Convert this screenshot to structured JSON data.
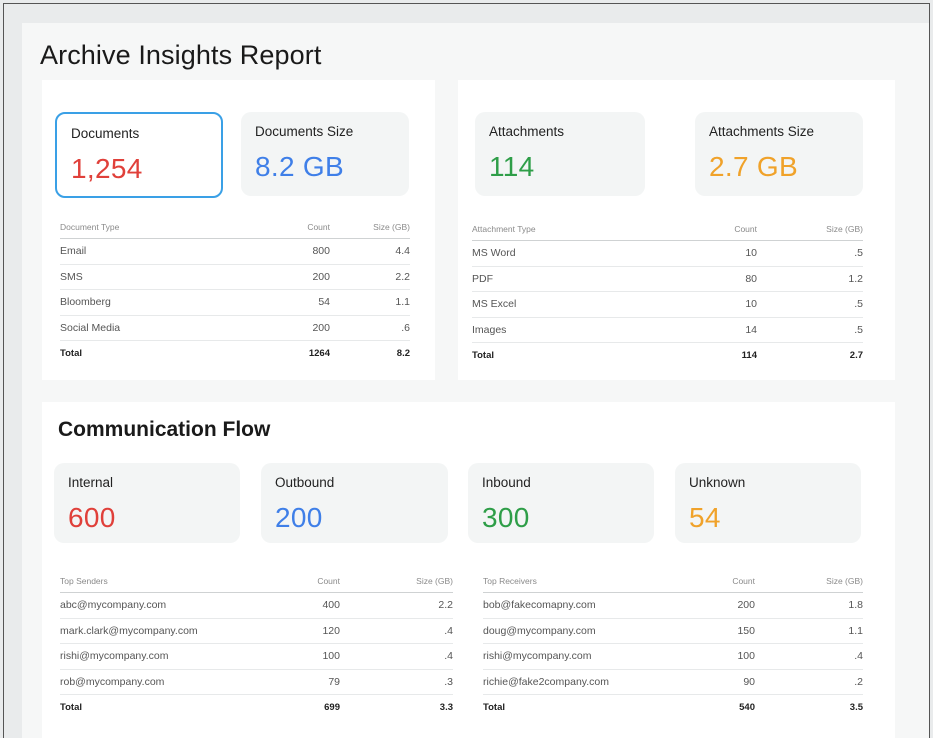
{
  "report": {
    "title": "Archive Insights Report"
  },
  "documents": {
    "cards": [
      {
        "label": "Documents",
        "value": "1,254",
        "color": "#e0403a"
      },
      {
        "label": "Documents Size",
        "value": "8.2 GB",
        "color": "#3f7fe8"
      }
    ],
    "table": {
      "headers": [
        "Document Type",
        "Count",
        "Size (GB)"
      ],
      "rows": [
        [
          "Email",
          "800",
          "4.4"
        ],
        [
          "SMS",
          "200",
          "2.2"
        ],
        [
          "Bloomberg",
          "54",
          "1.1"
        ],
        [
          "Social Media",
          "200",
          ".6"
        ]
      ],
      "total": [
        "Total",
        "1264",
        "8.2"
      ]
    }
  },
  "attachments": {
    "cards": [
      {
        "label": "Attachments",
        "value": "114",
        "color": "#2e9e48"
      },
      {
        "label": "Attachments Size",
        "value": "2.7 GB",
        "color": "#f0a22a"
      }
    ],
    "table": {
      "headers": [
        "Attachment Type",
        "Count",
        "Size (GB)"
      ],
      "rows": [
        [
          "MS Word",
          "10",
          ".5"
        ],
        [
          "PDF",
          "80",
          "1.2"
        ],
        [
          "MS Excel",
          "10",
          ".5"
        ],
        [
          "Images",
          "14",
          ".5"
        ]
      ],
      "total": [
        "Total",
        "114",
        "2.7"
      ]
    }
  },
  "communication": {
    "title": "Communication Flow",
    "cards": [
      {
        "label": "Internal",
        "value": "600",
        "color": "#e0403a"
      },
      {
        "label": "Outbound",
        "value": "200",
        "color": "#3f7fe8"
      },
      {
        "label": "Inbound",
        "value": "300",
        "color": "#2e9e48"
      },
      {
        "label": "Unknown",
        "value": "54",
        "color": "#f0a22a"
      }
    ],
    "senders": {
      "headers": [
        "Top Senders",
        "Count",
        "Size (GB)"
      ],
      "rows": [
        [
          "abc@mycompany.com",
          "400",
          "2.2"
        ],
        [
          "mark.clark@mycompany.com",
          "120",
          ".4"
        ],
        [
          "rishi@mycompany.com",
          "100",
          ".4"
        ],
        [
          "rob@mycompany.com",
          "79",
          ".3"
        ]
      ],
      "total": [
        "Total",
        "699",
        "3.3"
      ]
    },
    "receivers": {
      "headers": [
        "Top Receivers",
        "Count",
        "Size (GB)"
      ],
      "rows": [
        [
          "bob@fakecomapny.com",
          "200",
          "1.8"
        ],
        [
          "doug@mycompany.com",
          "150",
          "1.1"
        ],
        [
          "rishi@mycompany.com",
          "100",
          ".4"
        ],
        [
          "richie@fake2company.com",
          "90",
          ".2"
        ]
      ],
      "total": [
        "Total",
        "540",
        "3.5"
      ]
    }
  }
}
